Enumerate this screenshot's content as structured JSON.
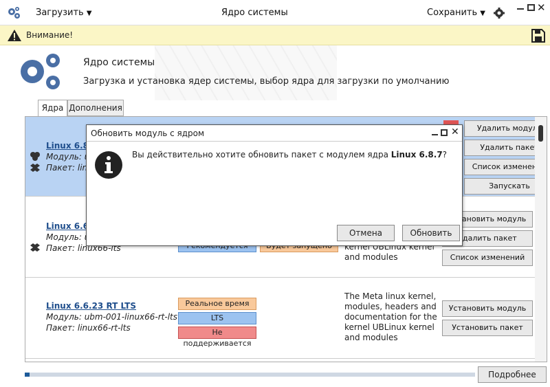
{
  "window": {
    "title": "Ядро системы",
    "load_label": "Загрузить",
    "save_label": "Сохранить"
  },
  "warning": {
    "text": "Внимание!"
  },
  "header": {
    "title": "Ядро системы",
    "subtitle": "Загрузка и установка ядер системы, выбор ядра для загрузки по умолчанию"
  },
  "tabs": [
    {
      "label": "Ядра"
    },
    {
      "label": "Дополнения"
    }
  ],
  "rows": [
    {
      "name": "Linux 6.8.",
      "module": "Модуль: u",
      "package": "Пакет: linu",
      "buttons": [
        "Удалить модуль",
        "Удалить пакет",
        "Список изменений",
        "Запускать"
      ]
    },
    {
      "name": "Linux 6.6.",
      "module": "Модуль: u",
      "package": "Пакет: linux66-lts",
      "tags": [
        "Рекомендуется",
        "Будет запущено"
      ],
      "desc": [
        "kernel UBLinux kernel",
        "and modules"
      ],
      "buttons": [
        "Установить модуль",
        "Удалить пакет",
        "Список изменений"
      ]
    },
    {
      "name": "Linux 6.6.23 RT LTS",
      "module": "Модуль: ubm-001-linux66-rt-lts",
      "package": "Пакет: linux66-rt-lts",
      "tags": [
        "Реальное время",
        "LTS",
        "Не поддерживается"
      ],
      "desc": [
        "The Meta linux kernel,",
        "modules, headers and",
        "documentation for the",
        "kernel UBLinux kernel",
        "and modules"
      ],
      "buttons": [
        "Установить модуль",
        "Установить пакет"
      ]
    }
  ],
  "dialog": {
    "title": "Обновить модуль с ядром",
    "message_prefix": "Вы действительно хотите обновить пакет с модулем ядра ",
    "message_bold": "Linux 6.8.7",
    "message_suffix": "?",
    "cancel_label": "Отмена",
    "ok_label": "Обновить"
  },
  "footer": {
    "more_label": "Подробнее",
    "progress": 0.01
  },
  "colors": {
    "accent": "#4a6fa5",
    "selected_row": "#b9d3f3",
    "warning_bg": "#fbf6c6"
  }
}
